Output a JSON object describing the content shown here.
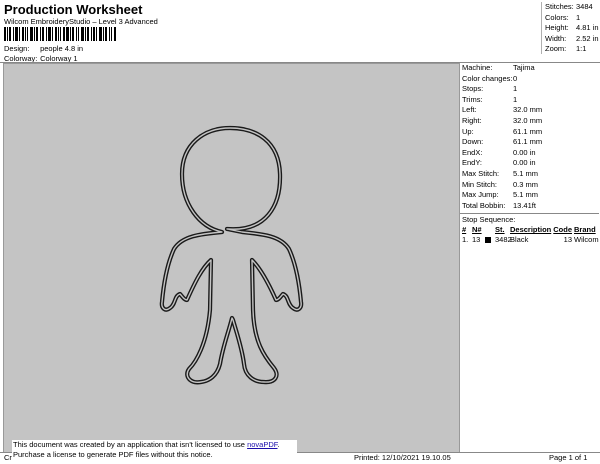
{
  "header": {
    "title": "Production Worksheet",
    "subtitle": "Wilcom EmbroideryStudio – Level 3 Advanced",
    "design_label": "Design:",
    "design_value": "people 4.8 in",
    "colorway_label": "Colorway:",
    "colorway_value": "Colorway 1"
  },
  "stats": [
    {
      "label": "Stitches:",
      "value": "3484"
    },
    {
      "label": "Colors:",
      "value": "1"
    },
    {
      "label": "Height:",
      "value": "4.81 in"
    },
    {
      "label": "Width:",
      "value": "2.52 in"
    },
    {
      "label": "Zoom:",
      "value": "1:1"
    }
  ],
  "machine_info": [
    {
      "label": "Machine:",
      "value": "Tajima"
    },
    {
      "label": "Color changes:",
      "value": "0"
    },
    {
      "label": "Stops:",
      "value": "1"
    },
    {
      "label": "Trims:",
      "value": "1"
    },
    {
      "label": "Left:",
      "value": "32.0 mm"
    },
    {
      "label": "Right:",
      "value": "32.0 mm"
    },
    {
      "label": "Up:",
      "value": "61.1 mm"
    },
    {
      "label": "Down:",
      "value": "61.1 mm"
    },
    {
      "label": "EndX:",
      "value": "0.00 in"
    },
    {
      "label": "EndY:",
      "value": "0.00 in"
    },
    {
      "label": "Max Stitch:",
      "value": "5.1 mm"
    },
    {
      "label": "Min Stitch:",
      "value": "0.3 mm"
    },
    {
      "label": "Max Jump:",
      "value": "5.1 mm"
    },
    {
      "label": "Total Bobbin:",
      "value": "13.41ft"
    }
  ],
  "stop_sequence": {
    "title": "Stop Sequence:",
    "headers": [
      "#",
      "N#",
      "",
      "St.",
      "Description",
      "Code",
      "Brand"
    ],
    "rows": [
      {
        "index": "1.",
        "needle": "13",
        "stitches": "3482",
        "description": "Black",
        "code": "13",
        "brand": "Wilcom",
        "swatch_color": "#000000"
      }
    ]
  },
  "footer": {
    "left_clip": "Cr",
    "printed": "Printed: 12/10/2021 19.10.05",
    "page": "Page 1 of 1"
  },
  "notice": {
    "line1_prefix": "This document was created by an application that isn't licensed to use ",
    "line1_link": "novaPDF",
    "line1_suffix": ".",
    "line2": "Purchase a license to generate PDF files without this notice."
  },
  "colors": {
    "canvas_bg": "#c4c4c4",
    "outline": "#1a1a1a",
    "link": "#1a0dab"
  }
}
